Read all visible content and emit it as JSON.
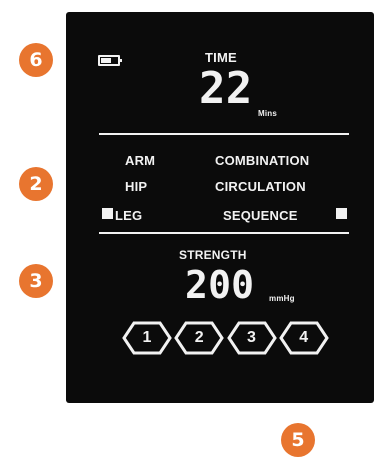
{
  "callouts": {
    "six": "6",
    "two": "2",
    "three": "3",
    "five": "5"
  },
  "display": {
    "time_label": "TIME",
    "time_value": "22",
    "time_unit": "Mins",
    "body_parts": {
      "arm": "ARM",
      "hip": "HIP",
      "leg": "LEG"
    },
    "modes": {
      "combination": "COMBINATION",
      "circulation": "CIRCULATION",
      "sequence": "SEQUENCE"
    },
    "strength_label": "STRENGTH",
    "strength_value": "200",
    "strength_unit": "mmHg",
    "program_buttons": [
      "1",
      "2",
      "3",
      "4"
    ]
  },
  "colors": {
    "callout": "#e8752f",
    "screen": "#0b0b0b",
    "segment": "#f2f2f2"
  },
  "icons": [
    "battery-icon",
    "leg-indicator-icon",
    "sequence-indicator-icon"
  ]
}
